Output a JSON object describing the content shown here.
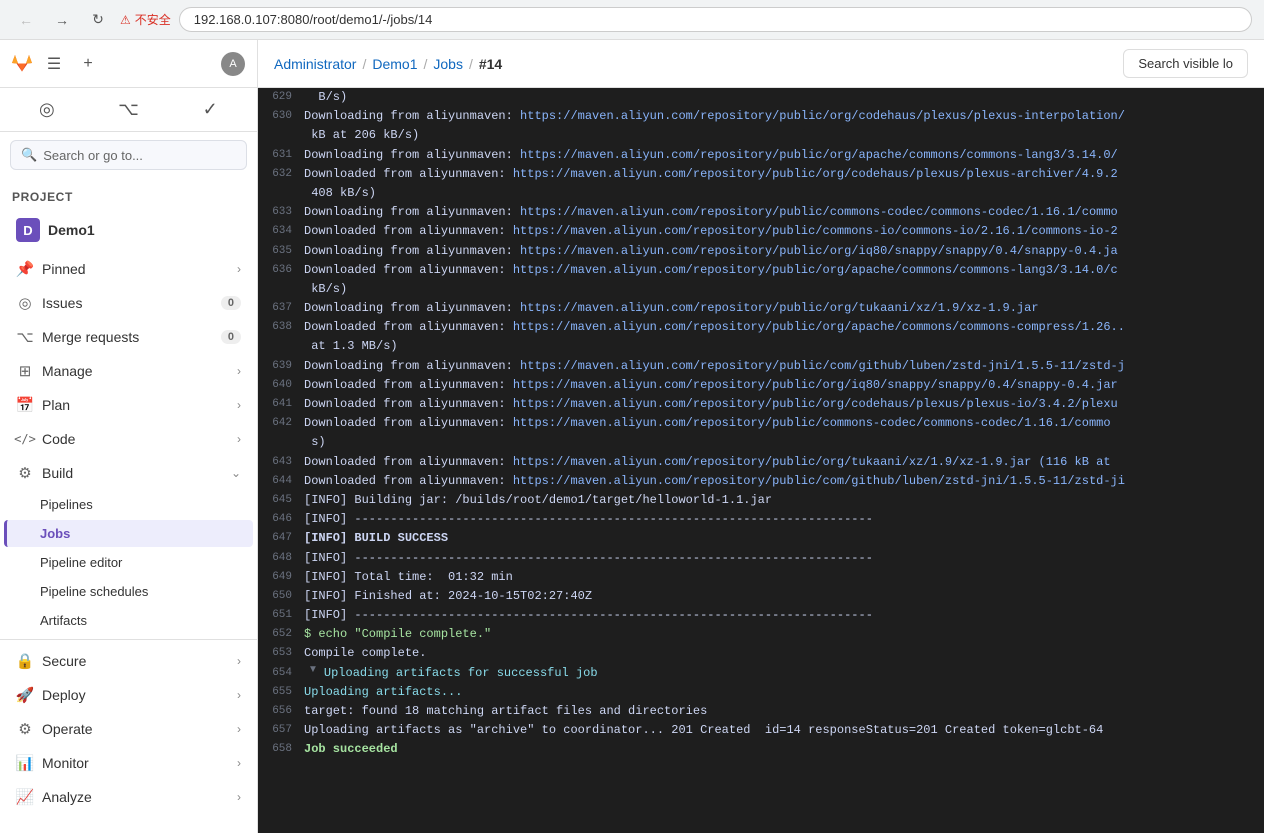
{
  "browser": {
    "url": "192.168.0.107:8080/root/demo1/-/jobs/14",
    "security_warning": "不安全"
  },
  "header": {
    "breadcrumbs": [
      "Administrator",
      "Demo1",
      "Jobs",
      "#14"
    ],
    "search_btn_label": "Search visible lo"
  },
  "sidebar": {
    "project_initial": "D",
    "project_name": "Demo1",
    "search_placeholder": "Search or go to...",
    "section_label": "Project",
    "nav_items": [
      {
        "id": "pinned",
        "label": "Pinned",
        "icon": "📌",
        "chevron": true
      },
      {
        "id": "issues",
        "label": "Issues",
        "icon": "◎",
        "badge": "0"
      },
      {
        "id": "merge-requests",
        "label": "Merge requests",
        "icon": "⌥",
        "badge": "0"
      },
      {
        "id": "manage",
        "label": "Manage",
        "icon": "⊞",
        "chevron": true
      },
      {
        "id": "plan",
        "label": "Plan",
        "icon": "📅",
        "chevron": true
      },
      {
        "id": "code",
        "label": "Code",
        "icon": "</>",
        "chevron": true
      },
      {
        "id": "build",
        "label": "Build",
        "icon": "⚙",
        "chevron": true,
        "expanded": true
      }
    ],
    "build_sub_items": [
      {
        "id": "pipelines",
        "label": "Pipelines",
        "active": false
      },
      {
        "id": "jobs",
        "label": "Jobs",
        "active": true
      },
      {
        "id": "pipeline-editor",
        "label": "Pipeline editor",
        "active": false
      },
      {
        "id": "pipeline-schedules",
        "label": "Pipeline schedules",
        "active": false
      },
      {
        "id": "artifacts",
        "label": "Artifacts",
        "active": false
      }
    ],
    "bottom_items": [
      {
        "id": "secure",
        "label": "Secure",
        "icon": "🔒",
        "chevron": true
      },
      {
        "id": "deploy",
        "label": "Deploy",
        "icon": "🚀",
        "chevron": true
      },
      {
        "id": "operate",
        "label": "Operate",
        "icon": "⚙",
        "chevron": true
      },
      {
        "id": "monitor",
        "label": "Monitor",
        "icon": "📊",
        "chevron": true
      },
      {
        "id": "analyze",
        "label": "Analyze",
        "icon": "📈",
        "chevron": true
      }
    ]
  },
  "log": {
    "lines": [
      {
        "num": 629,
        "text": "  B/s)",
        "class": ""
      },
      {
        "num": 630,
        "text": "Downloading from aliyunmaven: https://maven.aliyun.com/repository/public/org/codehaus/plexus/plexus-interpolation/",
        "class": "",
        "has_link": true,
        "link_start": 24,
        "link_text": "https://maven.aliyun.com/repository/public/org/codehaus/plexus/plexus-interpolation/"
      },
      {
        "num": "",
        "text": " kB at 206 kB/s)",
        "class": ""
      },
      {
        "num": 631,
        "text": "Downloading from aliyunmaven: https://maven.aliyun.com/repository/public/org/apache/commons/commons-lang3/3.14.0/",
        "class": "",
        "has_link": true
      },
      {
        "num": 632,
        "text": "Downloaded from aliyunmaven: https://maven.aliyun.com/repository/public/org/codehaus/plexus/plexus-archiver/4.9.2",
        "class": "",
        "has_link": true
      },
      {
        "num": "",
        "text": " 408 kB/s)",
        "class": ""
      },
      {
        "num": 633,
        "text": "Downloading from aliyunmaven: https://maven.aliyun.com/repository/public/commons-codec/commons-codec/1.16.1/commo",
        "class": "",
        "has_link": true
      },
      {
        "num": 634,
        "text": "Downloaded from aliyunmaven: https://maven.aliyun.com/repository/public/commons-io/commons-io/2.16.1/commons-io-2",
        "class": "",
        "has_link": true
      },
      {
        "num": 635,
        "text": "Downloading from aliyunmaven: https://maven.aliyun.com/repository/public/org/iq80/snappy/snappy/0.4/snappy-0.4.ja",
        "class": "",
        "has_link": true
      },
      {
        "num": 636,
        "text": "Downloaded from aliyunmaven: https://maven.aliyun.com/repository/public/org/apache/commons/commons-lang3/3.14.0/c",
        "class": "",
        "has_link": true
      },
      {
        "num": "",
        "text": " kB/s)",
        "class": ""
      },
      {
        "num": 637,
        "text": "Downloading from aliyunmaven: https://maven.aliyun.com/repository/public/org/tukaani/xz/1.9/xz-1.9.jar",
        "class": "",
        "has_link": true
      },
      {
        "num": 638,
        "text": "Downloaded from aliyunmaven: https://maven.aliyun.com/repository/public/org/apache/commons/commons-compress/1.26..",
        "class": "",
        "has_link": true
      },
      {
        "num": "",
        "text": " at 1.3 MB/s)",
        "class": ""
      },
      {
        "num": 639,
        "text": "Downloading from aliyunmaven: https://maven.aliyun.com/repository/public/com/github/luben/zstd-jni/1.5.5-11/zstd-j",
        "class": "",
        "has_link": true
      },
      {
        "num": 640,
        "text": "Downloaded from aliyunmaven: https://maven.aliyun.com/repository/public/org/iq80/snappy/snappy/0.4/snappy-0.4.jar",
        "class": "",
        "has_link": true
      },
      {
        "num": 641,
        "text": "Downloaded from aliyunmaven: https://maven.aliyun.com/repository/public/org/codehaus/plexus/plexus-io/3.4.2/plexu",
        "class": "",
        "has_link": true
      },
      {
        "num": 642,
        "text": "Downloaded from aliyunmaven: https://maven.aliyun.com/repository/public/commons-codec/commons-codec/1.16.1/commo",
        "class": "",
        "has_link": true
      },
      {
        "num": "",
        "text": " s)",
        "class": ""
      },
      {
        "num": 643,
        "text": "Downloaded from aliyunmaven: https://maven.aliyun.com/repository/public/org/tukaani/xz/1.9/xz-1.9.jar (116 kB at",
        "class": "",
        "has_link": true
      },
      {
        "num": 644,
        "text": "Downloaded from aliyunmaven: https://maven.aliyun.com/repository/public/com/github/luben/zstd-jni/1.5.5-11/zstd-ji",
        "class": "",
        "has_link": true
      },
      {
        "num": 645,
        "text": "[INFO] Building jar: /builds/root/demo1/target/helloworld-1.1.jar",
        "class": ""
      },
      {
        "num": 646,
        "text": "[INFO] ------------------------------------------------------------------------",
        "class": ""
      },
      {
        "num": 647,
        "text": "[INFO] BUILD SUCCESS",
        "class": "bold"
      },
      {
        "num": 648,
        "text": "[INFO] ------------------------------------------------------------------------",
        "class": ""
      },
      {
        "num": 649,
        "text": "[INFO] Total time:  01:32 min",
        "class": ""
      },
      {
        "num": 650,
        "text": "[INFO] Finished at: 2024-10-15T02:27:40Z",
        "class": ""
      },
      {
        "num": 651,
        "text": "[INFO] ------------------------------------------------------------------------",
        "class": ""
      },
      {
        "num": 652,
        "text": "$ echo \"Compile complete.\"",
        "class": "green"
      },
      {
        "num": 653,
        "text": "Compile complete.",
        "class": ""
      },
      {
        "num": 654,
        "text": "Uploading artifacts for successful job",
        "class": "cyan",
        "collapse": true
      },
      {
        "num": 655,
        "text": "Uploading artifacts...",
        "class": "cyan"
      },
      {
        "num": 656,
        "text": "target: found 18 matching artifact files and directories",
        "class": ""
      },
      {
        "num": 657,
        "text": "Uploading artifacts as \"archive\" to coordinator... 201 Created  id=14 responseStatus=201 Created token=glcbt-64",
        "class": ""
      },
      {
        "num": 658,
        "text": "Job succeeded",
        "class": "green bold"
      }
    ]
  }
}
